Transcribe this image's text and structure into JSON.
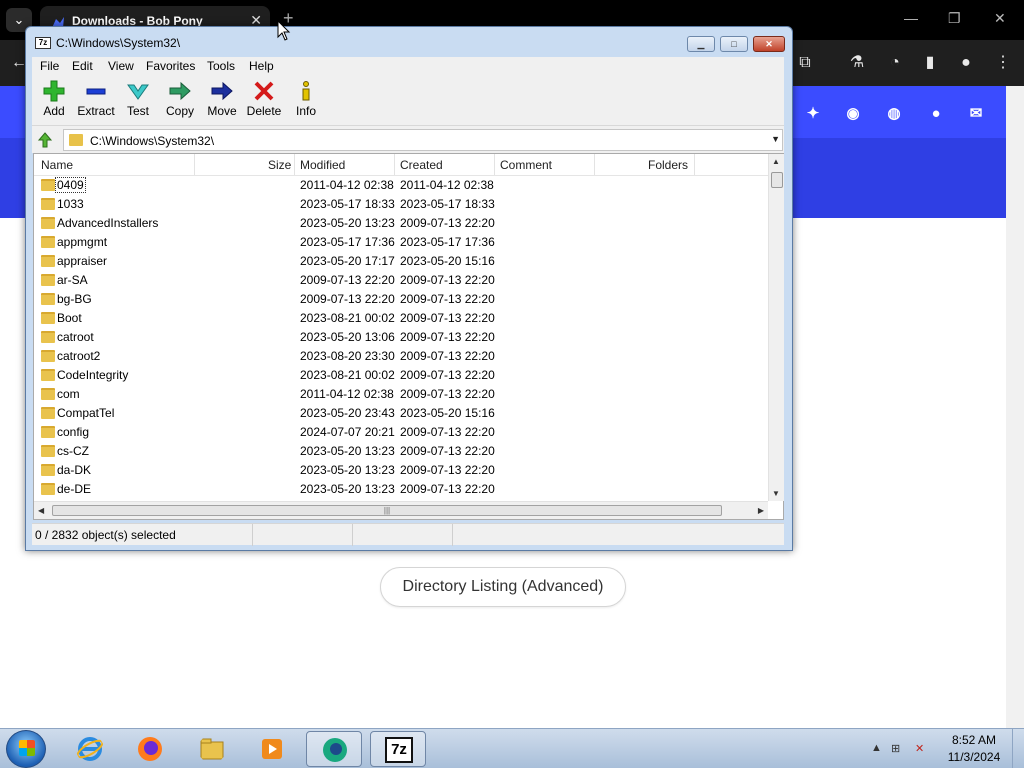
{
  "browser": {
    "tab_menu_glyph": "⌄",
    "tab_title": "Downloads - Bob Pony",
    "tab_close_glyph": "✕",
    "new_tab_glyph": "+",
    "window_minimize": "—",
    "window_restore": "❐",
    "window_close": "✕",
    "toolbar_icons": [
      "back-arrow-icon",
      "extensions-icon",
      "labs-icon",
      "copilot-icon",
      "sidebar-icon",
      "profile-icon",
      "more-icon"
    ],
    "back_glyph": "←",
    "more_glyph": "⋮"
  },
  "site": {
    "banner_color": "#2f3fe4",
    "social_icons": [
      "bluesky-icon",
      "mastodon-icon",
      "discord-icon",
      "github-icon",
      "email-icon"
    ],
    "directory_listing_button": "Directory Listing (Advanced)"
  },
  "sevenzip": {
    "title": "C:\\Windows\\System32\\",
    "title_icon_text": "7z",
    "menu": [
      "File",
      "Edit",
      "View",
      "Favorites",
      "Tools",
      "Help"
    ],
    "toolbar": [
      {
        "label": "Add",
        "icon": "add-icon"
      },
      {
        "label": "Extract",
        "icon": "extract-icon"
      },
      {
        "label": "Test",
        "icon": "test-icon"
      },
      {
        "label": "Copy",
        "icon": "copy-icon"
      },
      {
        "label": "Move",
        "icon": "move-icon"
      },
      {
        "label": "Delete",
        "icon": "delete-icon"
      },
      {
        "label": "Info",
        "icon": "info-icon"
      }
    ],
    "address": "C:\\Windows\\System32\\",
    "columns": [
      "Name",
      "Size",
      "Modified",
      "Created",
      "Comment",
      "Folders"
    ],
    "rows": [
      {
        "name": "0409",
        "modified": "2011-04-12 02:38",
        "created": "2011-04-12 02:38"
      },
      {
        "name": "1033",
        "modified": "2023-05-17 18:33",
        "created": "2023-05-17 18:33"
      },
      {
        "name": "AdvancedInstallers",
        "modified": "2023-05-20 13:23",
        "created": "2009-07-13 22:20"
      },
      {
        "name": "appmgmt",
        "modified": "2023-05-17 17:36",
        "created": "2023-05-17 17:36"
      },
      {
        "name": "appraiser",
        "modified": "2023-05-20 17:17",
        "created": "2023-05-20 15:16"
      },
      {
        "name": "ar-SA",
        "modified": "2009-07-13 22:20",
        "created": "2009-07-13 22:20"
      },
      {
        "name": "bg-BG",
        "modified": "2009-07-13 22:20",
        "created": "2009-07-13 22:20"
      },
      {
        "name": "Boot",
        "modified": "2023-08-21 00:02",
        "created": "2009-07-13 22:20"
      },
      {
        "name": "catroot",
        "modified": "2023-05-20 13:06",
        "created": "2009-07-13 22:20"
      },
      {
        "name": "catroot2",
        "modified": "2023-08-20 23:30",
        "created": "2009-07-13 22:20"
      },
      {
        "name": "CodeIntegrity",
        "modified": "2023-08-21 00:02",
        "created": "2009-07-13 22:20"
      },
      {
        "name": "com",
        "modified": "2011-04-12 02:38",
        "created": "2009-07-13 22:20"
      },
      {
        "name": "CompatTel",
        "modified": "2023-05-20 23:43",
        "created": "2023-05-20 15:16"
      },
      {
        "name": "config",
        "modified": "2024-07-07 20:21",
        "created": "2009-07-13 22:20"
      },
      {
        "name": "cs-CZ",
        "modified": "2023-05-20 13:23",
        "created": "2009-07-13 22:20"
      },
      {
        "name": "da-DK",
        "modified": "2023-05-20 13:23",
        "created": "2009-07-13 22:20"
      },
      {
        "name": "de-DE",
        "modified": "2023-05-20 13:23",
        "created": "2009-07-13 22:20"
      }
    ],
    "status": "0 / 2832 object(s) selected"
  },
  "taskbar": {
    "apps": [
      "start-orb",
      "internet-explorer-icon",
      "firefox-icon",
      "file-explorer-icon",
      "media-player-icon",
      "copilot-app-icon",
      "7zip-icon"
    ],
    "sevenzip_label": "7z",
    "time": "8:52 AM",
    "date": "11/3/2024",
    "tray_glyphs": [
      "▲",
      "⊞",
      "✕"
    ]
  }
}
